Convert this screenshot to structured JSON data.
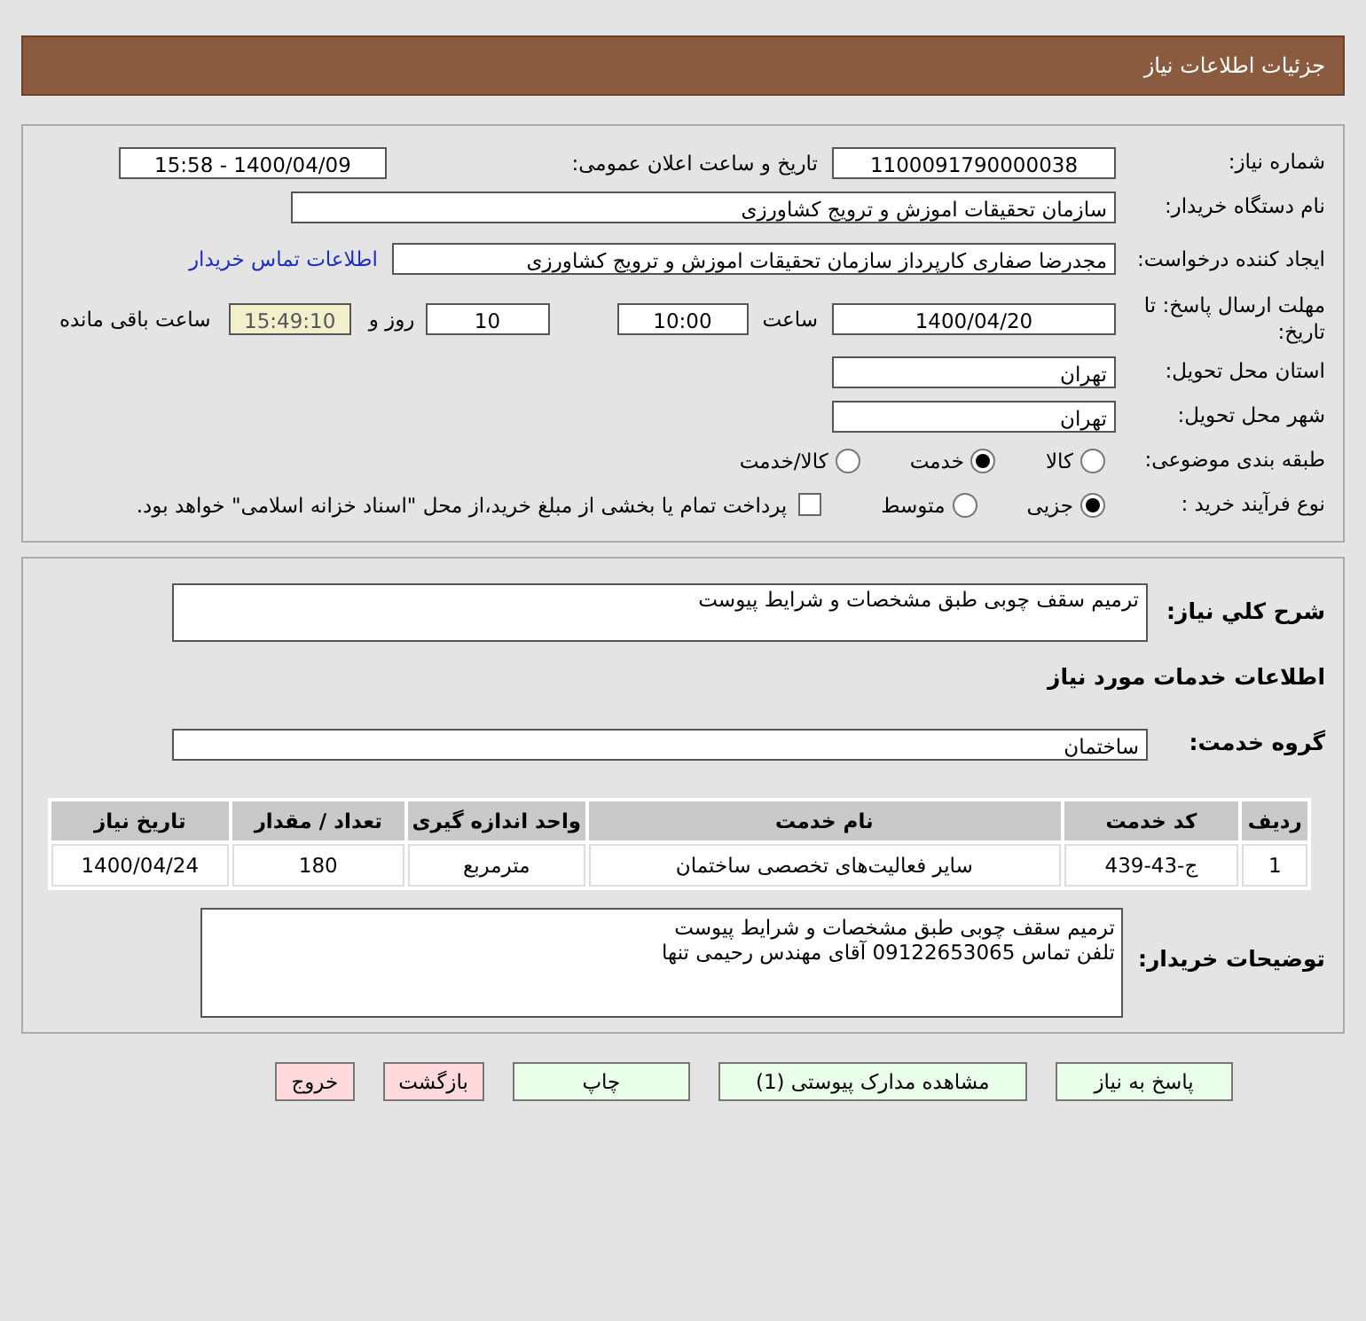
{
  "header": {
    "title": "جزئیات اطلاعات نیاز"
  },
  "need_number": {
    "label": "شماره نیاز:",
    "value": "1100091790000038"
  },
  "announce": {
    "label": "تاریخ و ساعت اعلان عمومی:",
    "value": "1400/04/09 - 15:58"
  },
  "buyer_org": {
    "label": "نام دستگاه خریدار:",
    "value": "سازمان تحقیقات  اموزش و ترویج کشاورزی"
  },
  "creator": {
    "label": "ایجاد کننده درخواست:",
    "value": "مجدرضا صفاری کارپرداز سازمان تحقیقات  اموزش و ترویج کشاورزی",
    "link": "اطلاعات تماس خریدار"
  },
  "deadline": {
    "label": "مهلت ارسال پاسخ: تا تاریخ:",
    "date": "1400/04/20",
    "time_label": "ساعت",
    "time": "10:00",
    "days": "10",
    "days_label": "روز و",
    "remaining": "15:49:10",
    "remaining_label": "ساعت باقی مانده"
  },
  "province": {
    "label": "استان محل تحویل:",
    "value": "تهران"
  },
  "city": {
    "label": "شهر محل تحویل:",
    "value": "تهران"
  },
  "category": {
    "label": "طبقه بندی موضوعی:",
    "options": [
      {
        "label": "کالا",
        "selected": false
      },
      {
        "label": "خدمت",
        "selected": true
      },
      {
        "label": "کالا/خدمت",
        "selected": false
      }
    ]
  },
  "process": {
    "label": "نوع فرآیند خرید :",
    "options": [
      {
        "label": "جزیی",
        "selected": true
      },
      {
        "label": "متوسط",
        "selected": false
      }
    ],
    "payment": {
      "label": "پرداخت تمام یا بخشی از مبلغ خرید،از محل \"اسناد خزانه اسلامی\" خواهد بود.",
      "checked": false
    }
  },
  "summary": {
    "label": "شرح كلي نياز:",
    "value": "ترمیم سقف چوبی طبق مشخصات و شرایط پیوست"
  },
  "services_heading": "اطلاعات خدمات مورد نیاز",
  "service_group": {
    "label": "گروه خدمت:",
    "value": "ساختمان"
  },
  "table": {
    "columns": [
      "ردیف",
      "کد خدمت",
      "نام خدمت",
      "واحد اندازه گیری",
      "تعداد / مقدار",
      "تاریخ نیاز"
    ],
    "rows": [
      [
        "1",
        "ج-43-439",
        "سایر فعالیت‌های تخصصی ساختمان",
        "مترمربع",
        "180",
        "1400/04/24"
      ]
    ]
  },
  "buyer_notes": {
    "label": "توضیحات خریدار:",
    "lines": [
      "ترمیم سقف چوبی طبق مشخصات و شرایط پیوست",
      "تلفن تماس 09122653065 آقای مهندس رحیمی تنها"
    ]
  },
  "buttons": [
    {
      "label": "پاسخ به نیاز",
      "kind": "action"
    },
    {
      "label": "مشاهده مدارک پیوستی (1)",
      "kind": "action"
    },
    {
      "label": "چاپ",
      "kind": "action"
    },
    {
      "label": "بازگشت",
      "kind": "exit"
    },
    {
      "label": "خروج",
      "kind": "exit"
    }
  ]
}
